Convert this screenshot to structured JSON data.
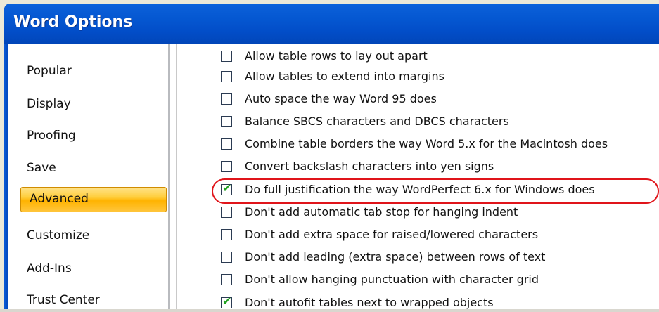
{
  "window": {
    "title": "Word Options"
  },
  "sidebar": {
    "items": [
      {
        "label": "Popular",
        "selected": false
      },
      {
        "label": "Display",
        "selected": false
      },
      {
        "label": "Proofing",
        "selected": false
      },
      {
        "label": "Save",
        "selected": false
      },
      {
        "label": "Advanced",
        "selected": true
      },
      {
        "label": "Customize",
        "selected": false
      },
      {
        "label": "Add-Ins",
        "selected": false
      },
      {
        "label": "Trust Center",
        "selected": false
      }
    ]
  },
  "options": [
    {
      "label": "Allow table rows to lay out apart",
      "checked": false
    },
    {
      "label": "Allow tables to extend into margins",
      "checked": false
    },
    {
      "label": "Auto space the way Word 95 does",
      "checked": false
    },
    {
      "label": "Balance SBCS characters and DBCS characters",
      "checked": false
    },
    {
      "label": "Combine table borders the way Word 5.x for the Macintosh does",
      "checked": false
    },
    {
      "label": "Convert backslash characters into yen signs",
      "checked": false
    },
    {
      "label": "Do full justification the way WordPerfect 6.x for Windows does",
      "checked": true
    },
    {
      "label": "Don't add automatic tab stop for hanging indent",
      "checked": false
    },
    {
      "label": "Don't add extra space for raised/lowered characters",
      "checked": false
    },
    {
      "label": "Don't add leading (extra space) between rows of text",
      "checked": false
    },
    {
      "label": "Don't allow hanging punctuation with character grid",
      "checked": false
    },
    {
      "label": "Don't autofit tables next to wrapped objects",
      "checked": true
    }
  ],
  "colors": {
    "title_bar": "#0558d2",
    "selected_nav": "#ffc53b",
    "highlight_ring": "#e0141a",
    "checkmark": "#21a121"
  },
  "icons": {
    "check": "check-mark-icon"
  }
}
